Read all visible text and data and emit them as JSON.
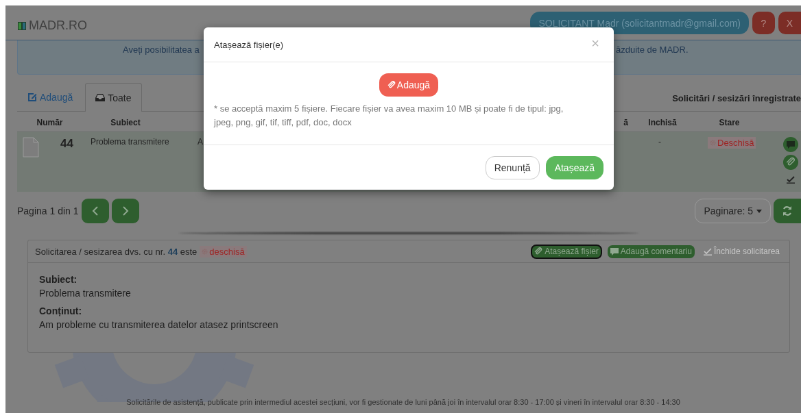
{
  "header": {
    "logo": "MADR.RO",
    "user": "SOLICITANT Madr (solicitantmadr@gmail.com)",
    "help_button": "?",
    "exit_button": "X"
  },
  "info_banner": {
    "text_left": "Aveți posibilitatea a",
    "text_right": "ăzduite de MADR."
  },
  "tabs": [
    {
      "label": "Adaugă",
      "kind": "add",
      "selected": false
    },
    {
      "label": "Toate",
      "kind": "all",
      "selected": true
    }
  ],
  "list_title": "Solicitări / sesizări înregistrate",
  "table": {
    "columns": [
      "Număr",
      "Subiect",
      "ă",
      "Inchisă",
      "Stare"
    ],
    "rows": [
      {
        "number": "44",
        "subject": "Problema transmitere",
        "column_3": "A",
        "closed": "-",
        "status": "Deschisă",
        "open": true
      }
    ]
  },
  "pagination": {
    "text": "Pagina 1 din 1",
    "page_size": "Paginare: 5"
  },
  "detail": {
    "title": "Solicitarea / sesizarea dvs. cu nr. **44** este",
    "status": "deschisă",
    "open": true,
    "buttons": [
      {
        "label": "Atașează fișier",
        "kind": "attach",
        "disabled": false
      },
      {
        "label": "Adaugă comentariu",
        "kind": "comment",
        "disabled": false
      },
      {
        "label": "Închide solicitarea",
        "kind": "close",
        "disabled": true
      }
    ],
    "fields": [
      {
        "label": "Subiect:",
        "value": "Problema transmitere"
      },
      {
        "label": "Conținut:",
        "value": "Am probleme cu transmiterea datelor atasez printscreen"
      }
    ]
  },
  "footer": "Solicitările de asistență, publicate prin intermediul acestei secțiuni, vor fi gestionate de luni până joi în intervalul orar 8:30 - 17:00 și vineri în intervalul orar 8:30 - 14:30",
  "modal": {
    "title": "Atașează fișier(e)",
    "close": "×",
    "add_button": "Adaugă",
    "note": "* se acceptă maxim 5 fișiere. Fiecare fișier va avea maxim 10 MB și poate fi de tipul: jpg, jpeg, png, gif, tif, tiff, pdf, doc, docx",
    "cancel_button": "Renunță",
    "confirm_button": "Atașează"
  }
}
